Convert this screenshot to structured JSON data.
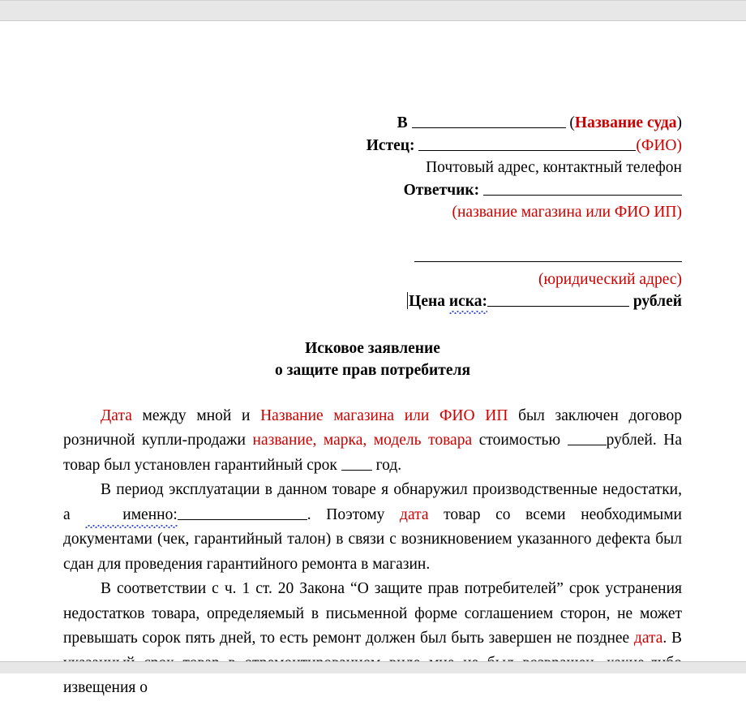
{
  "document": {
    "type": "legal-claim-statement",
    "language": "ru",
    "accent_red": "#cc0000",
    "spellcheck_underline_color": "#3a53c8",
    "page_background": "#ffffff",
    "viewer_gap_color": "#e7e7e7"
  },
  "header": {
    "line_court": {
      "label": "В",
      "hint_open": "(",
      "hint": "Название суда",
      "hint_close": ")"
    },
    "line_plaintiff": {
      "label": "Истец:",
      "hint_open": "(",
      "hint": "ФИО",
      "hint_close": ")"
    },
    "line_postal": {
      "text": "Почтовый адрес, контактный телефон"
    },
    "line_defendant": {
      "label": "Ответчик:"
    },
    "line_defendant_hint": {
      "text": "(название магазина или ФИО ИП)"
    },
    "line_legal_address_hint": {
      "text": "(юридический адрес)"
    },
    "line_claim_price": {
      "label_a": "Цена",
      "label_b": "иска:",
      "suffix": "рублей"
    }
  },
  "title": {
    "line1": "Исковое заявление",
    "line2": "о защите прав потребителя"
  },
  "body": {
    "p1": {
      "s1_red": "Дата",
      "s2": " между мной и ",
      "s3_red": "Название магазина или ФИО ИП",
      "s4": " был заключен договор розничной купли-продажи ",
      "s5_red": "название, марка, модель товара",
      "s6": " стоимостью ",
      "s7": "рублей. На товар был установлен гарантийный срок ",
      "s8": " год."
    },
    "p2": {
      "s1": "В период эксплуатации в данном товаре я обнаружил производственные недостатки, а ",
      "s2_wavy": "именно:",
      "s3": ". Поэтому ",
      "s4_red": "дата",
      "s5": " товар со всеми необходимыми документами (чек, гарантийный талон) в связи с возникновением указанного дефекта был сдан для проведения гарантийного ремонта в магазин."
    },
    "p3": {
      "s1": "В соответствии с ч. 1 ст. 20 Закона “О защите прав потребителей” срок устранения недостатков товара, определяемый в письменной форме соглашением сторон, не может превышать сорок пять дней, то есть ремонт должен был быть завершен не позднее ",
      "s2_red": "дата",
      "s3": ". В указанный срок товар в отремонтированном виде мне не был возвращен, какие-либо извещения о"
    }
  }
}
